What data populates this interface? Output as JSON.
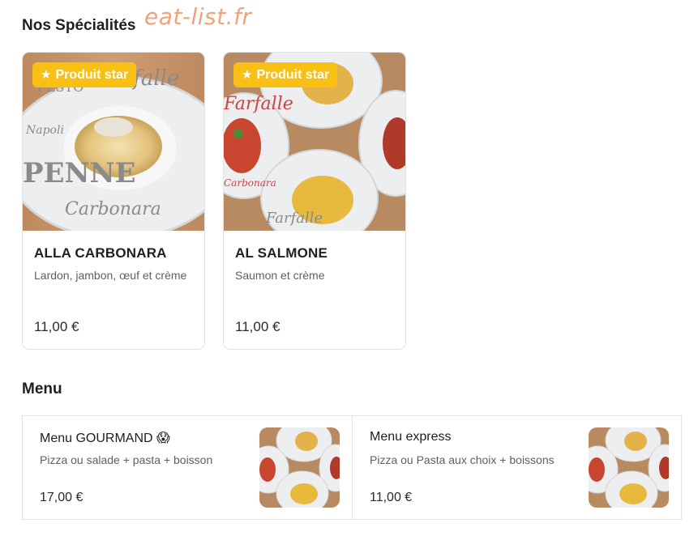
{
  "watermark": "eat-list.fr",
  "specialties": {
    "title": "Nos Spécialités",
    "items": [
      {
        "badge": "Produit star",
        "name": "ALLA CARBONARA",
        "description": "Lardon, jambon, œuf et crème",
        "price": "11,00 €",
        "plate_text": [
          "PESTO",
          "Farfalle",
          "Napoli",
          "PENNE",
          "Carbonara"
        ]
      },
      {
        "badge": "Produit star",
        "name": "AL SALMONE",
        "description": "Saumon et crème",
        "price": "11,00 €",
        "plate_text": [
          "Farfalle",
          "Carbonara",
          "Farfalle"
        ]
      }
    ]
  },
  "menu": {
    "title": "Menu",
    "items": [
      {
        "name": "Menu GOURMAND 😱",
        "description": "Pizza ou salade + pasta + boisson",
        "price": "17,00 €"
      },
      {
        "name": "Menu express",
        "description": "Pizza ou Pasta aux choix + boissons",
        "price": "11,00 €"
      }
    ]
  },
  "colors": {
    "badge": "#f8bf14",
    "watermark": "#f0a37a",
    "text": "#1f1f1f",
    "muted": "#5f5f5f",
    "border": "#e3e3e3"
  },
  "icons": {
    "badge_icon": "star-icon"
  }
}
